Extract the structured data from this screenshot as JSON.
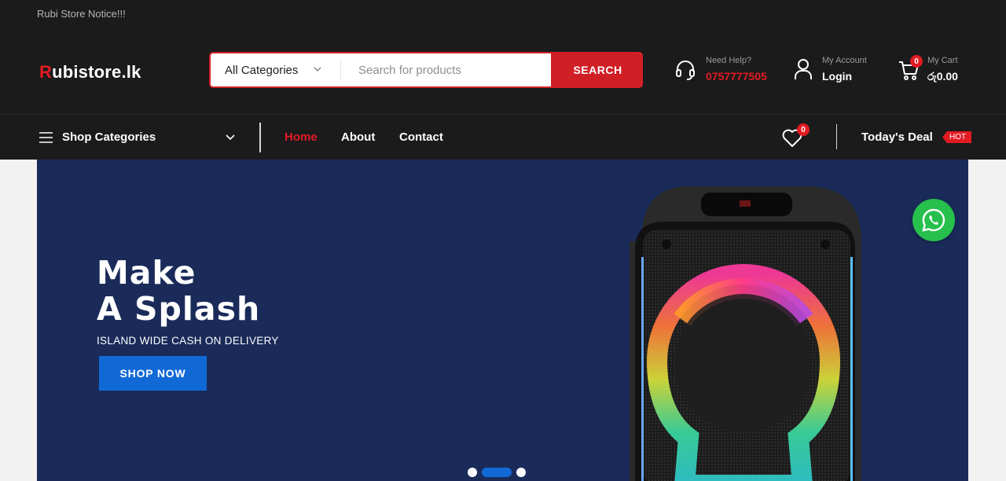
{
  "topbar": {
    "notice": "Rubi Store Notice!!!"
  },
  "header": {
    "logo_first": "R",
    "logo_rest": "ubistore.lk",
    "search": {
      "category": "All Categories",
      "placeholder": "Search for products",
      "button": "SEARCH"
    },
    "help": {
      "label": "Need Help?",
      "phone": "0757777505"
    },
    "account": {
      "label": "My Account",
      "action": "Login"
    },
    "cart": {
      "label": "My Cart",
      "total": "රු0.00",
      "count": "0"
    }
  },
  "nav": {
    "shop_categories": "Shop Categories",
    "links": [
      "Home",
      "About",
      "Contact"
    ],
    "active": "Home",
    "wishlist_count": "0",
    "deal": "Today's Deal",
    "deal_badge": "HOT"
  },
  "hero": {
    "title_line1": "Make",
    "title_line2": "A Splash",
    "subtitle": "ISLAND WIDE CASH ON DELIVERY",
    "button": "SHOP NOW",
    "slides_total": 3,
    "active_slide": 2
  },
  "colors": {
    "accent": "#e21b23",
    "hero_bg": "#1a2b5a",
    "cta_blue": "#1169d6",
    "whatsapp": "#27c04d"
  }
}
